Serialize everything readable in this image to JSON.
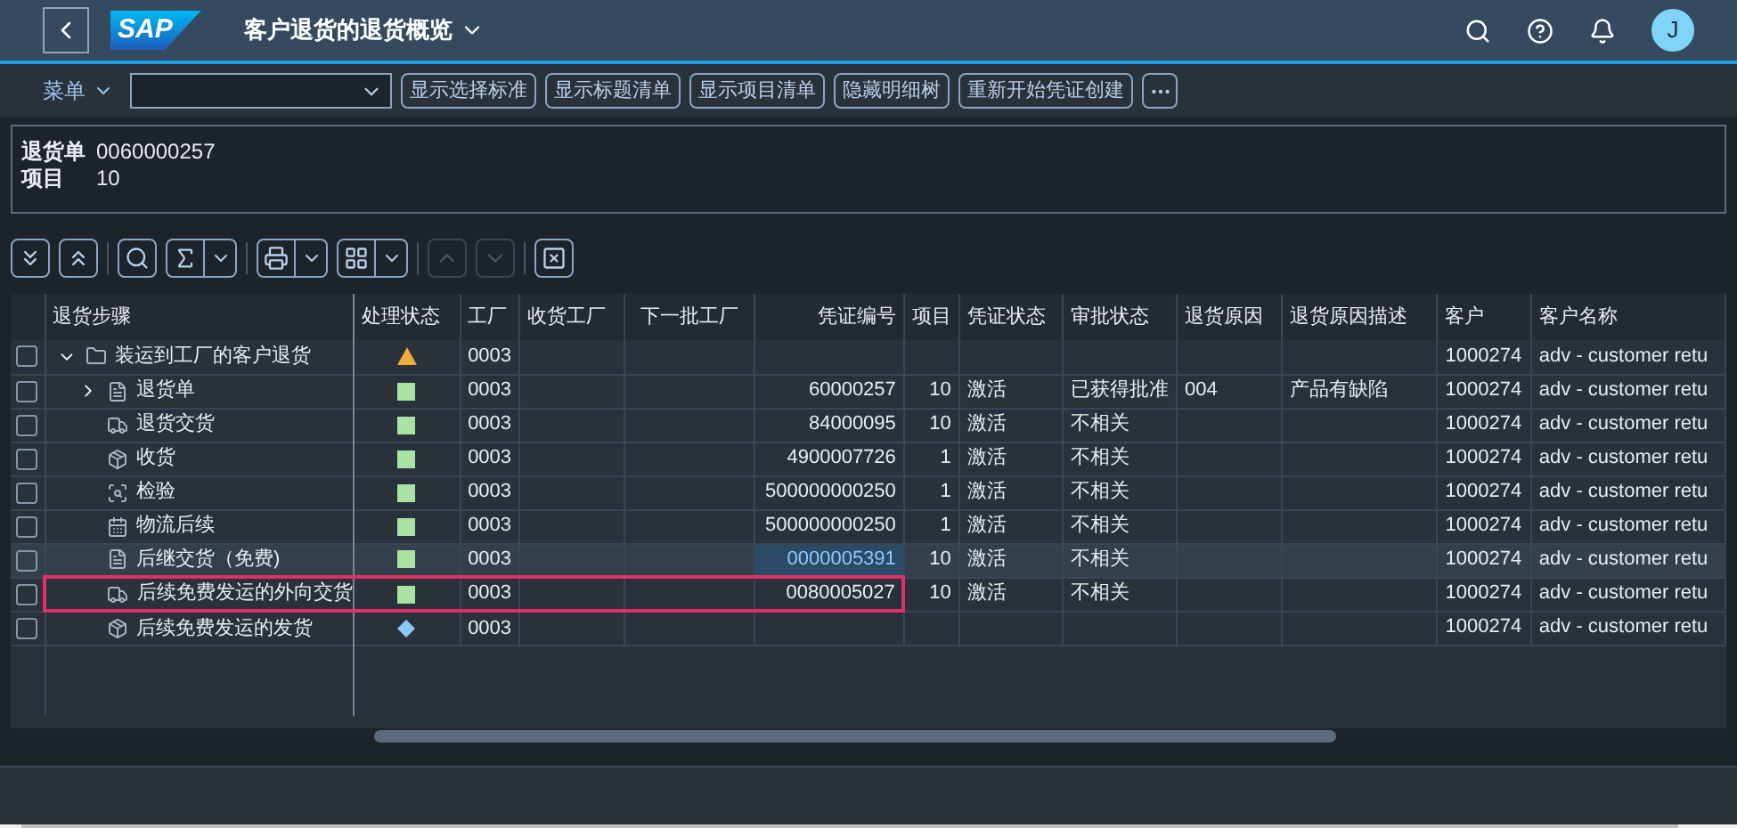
{
  "shell": {
    "logo": "SAP",
    "title": "客户退货的退货概览",
    "avatar": "J"
  },
  "toolbar": {
    "menu": "菜单",
    "buttons": [
      "显示选择标准",
      "显示标题清单",
      "显示项目清单",
      "隐藏明细树",
      "重新开始凭证创建"
    ]
  },
  "header": {
    "fields": [
      {
        "label": "退货单",
        "value": "0060000257"
      },
      {
        "label": "项目",
        "value": "10"
      }
    ]
  },
  "table": {
    "columns": [
      "退货步骤",
      "处理状态",
      "工厂",
      "收货工厂",
      "下一批工厂",
      "凭证编号",
      "项目",
      "凭证状态",
      "审批状态",
      "退货原因",
      "退货原因描述",
      "客户",
      "客户名称"
    ],
    "rows": [
      {
        "step": "装运到工厂的客户退货",
        "kind": "folder",
        "status": {
          "kind": "warning"
        },
        "plant": "0003",
        "customer": "1000274",
        "customer_name": "adv - customer retu",
        "selected": false,
        "annotated": false,
        "expanded": true,
        "children": [
          {
            "step": "退货单",
            "kind": "order",
            "status": {
              "kind": "success"
            },
            "plant": "0003",
            "doc": "60000257",
            "item": "10",
            "doc_status": "激活",
            "approval": "已获得批准",
            "reason": "004",
            "reason_text": "产品有缺陷",
            "customer": "1000274",
            "customer_name": "adv - customer retu",
            "selected": false,
            "annotated": false,
            "expanded": false
          },
          {
            "step": "退货交货",
            "kind": "truck",
            "status": {
              "kind": "success"
            },
            "plant": "0003",
            "doc": "84000095",
            "item": "10",
            "doc_status": "激活",
            "approval": "不相关",
            "customer": "1000274",
            "customer_name": "adv - customer retu",
            "selected": false,
            "annotated": false
          },
          {
            "step": "收货",
            "kind": "receipt",
            "status": {
              "kind": "success"
            },
            "plant": "0003",
            "doc": "4900007726",
            "item": "1",
            "doc_status": "激活",
            "approval": "不相关",
            "customer": "1000274",
            "customer_name": "adv - customer retu",
            "selected": false,
            "annotated": false
          },
          {
            "step": "检验",
            "kind": "inspect",
            "status": {
              "kind": "success"
            },
            "plant": "0003",
            "doc": "500000000250",
            "item": "1",
            "doc_status": "激活",
            "approval": "不相关",
            "customer": "1000274",
            "customer_name": "adv - customer retu",
            "selected": false,
            "annotated": false
          },
          {
            "step": "物流后续",
            "kind": "calendar",
            "status": {
              "kind": "success"
            },
            "plant": "0003",
            "doc": "500000000250",
            "item": "1",
            "doc_status": "激活",
            "approval": "不相关",
            "customer": "1000274",
            "customer_name": "adv - customer retu",
            "selected": false,
            "annotated": false
          },
          {
            "step": "后继交货（免费)",
            "kind": "order",
            "status": {
              "kind": "success"
            },
            "plant": "0003",
            "doc": "0000005391",
            "item": "10",
            "doc_status": "激活",
            "approval": "不相关",
            "customer": "1000274",
            "customer_name": "adv - customer retu",
            "selected": true,
            "annotated": false
          },
          {
            "step": "后续免费发运的外向交货",
            "kind": "truck",
            "status": {
              "kind": "success"
            },
            "plant": "0003",
            "doc": "0080005027",
            "item": "10",
            "doc_status": "激活",
            "approval": "不相关",
            "customer": "1000274",
            "customer_name": "adv - customer retu",
            "selected": false,
            "annotated": true
          },
          {
            "step": "后续免费发运的发货",
            "kind": "receipt",
            "status": {
              "kind": "info"
            },
            "plant": "0003",
            "customer": "1000274",
            "customer_name": "adv - customer retu",
            "selected": false,
            "annotated": false
          }
        ]
      }
    ]
  }
}
